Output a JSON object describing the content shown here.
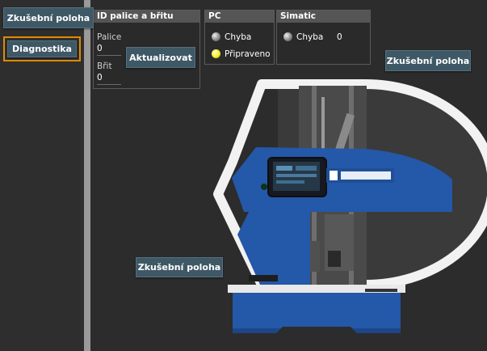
{
  "sidebar": {
    "top_button": "Zkušební poloha",
    "diagnostics_button": "Diagnostika"
  },
  "id_panel": {
    "title": "ID palice a břitu",
    "hammer_label": "Palice",
    "hammer_value": "0",
    "blade_label": "Břit",
    "blade_value": "0",
    "update_button": "Aktualizovat"
  },
  "pc_panel": {
    "title": "PC",
    "error_label": "Chyba",
    "ready_label": "Připraveno"
  },
  "simatic_panel": {
    "title": "Simatic",
    "error_label": "Chyba",
    "error_count": "0"
  },
  "main": {
    "test_position_right": "Zkušební poloha",
    "test_position_bottom": "Zkušební poloha"
  },
  "colors": {
    "button_bg": "#3f5866",
    "focus_border": "#e08a00",
    "machine_blue": "#2458a8",
    "led_ready": "#f4ef2a"
  },
  "icons": [
    "status-led-grey",
    "status-led-yellow",
    "machine-illustration"
  ]
}
